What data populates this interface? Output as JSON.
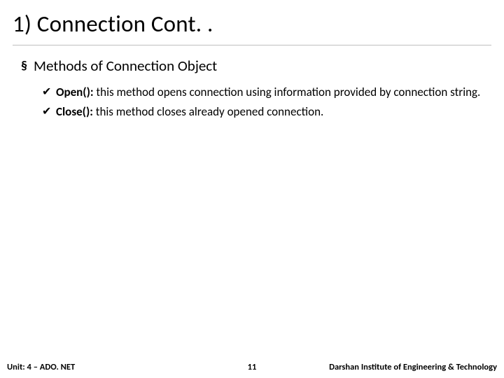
{
  "title": "1) Connection Cont. .",
  "section_bullet": "§",
  "section_heading": "Methods of Connection Object",
  "check_glyph": "✔",
  "items": [
    {
      "name": "Open():",
      "desc": " this method opens connection using information provided by connection string."
    },
    {
      "name": "Close():",
      "desc": " this method closes already opened connection."
    }
  ],
  "footer": {
    "left": "Unit: 4 – ADO. NET",
    "center": "11",
    "right": "Darshan Institute of Engineering & Technology"
  }
}
